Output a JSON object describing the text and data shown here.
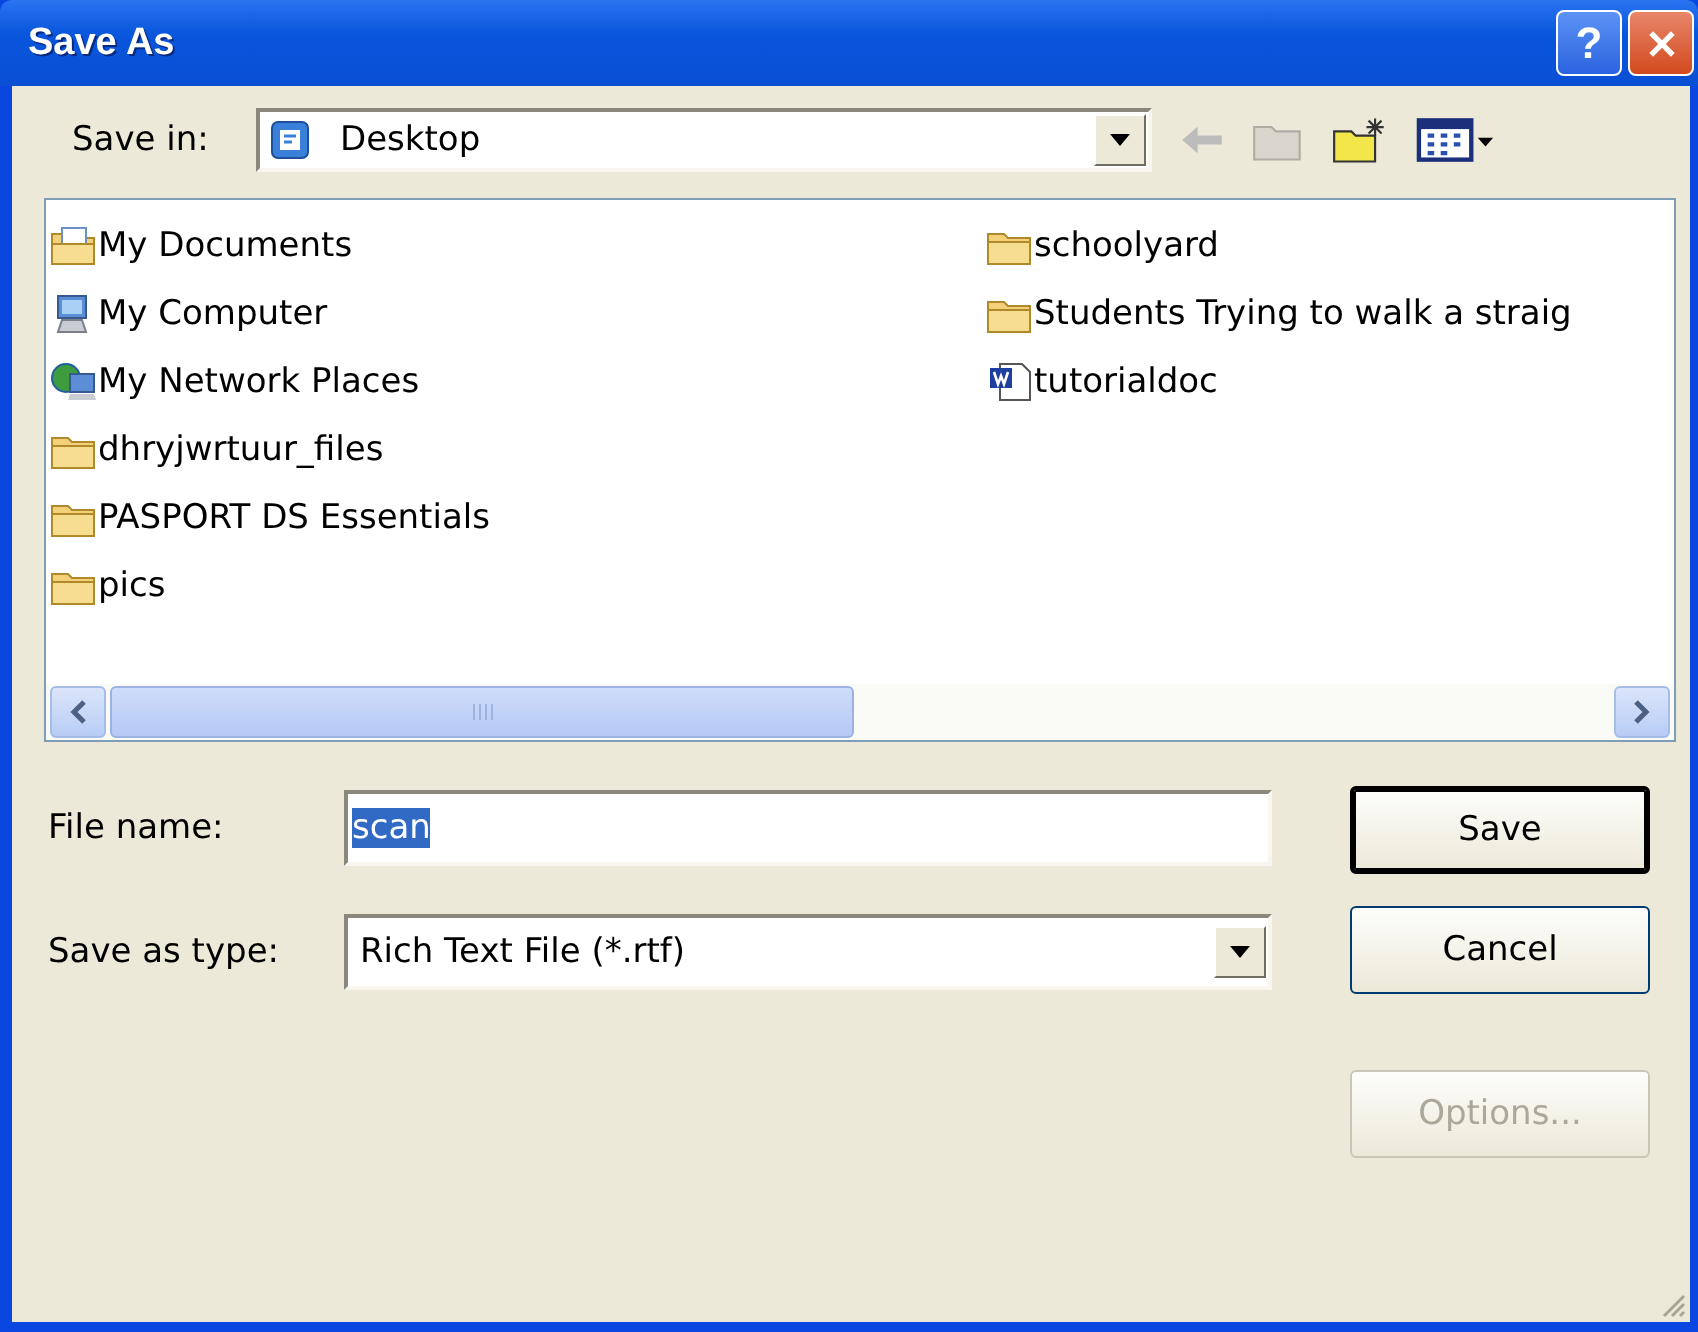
{
  "window": {
    "title": "Save As",
    "help_glyph": "?"
  },
  "save_in": {
    "label": "Save in:",
    "value": "Desktop",
    "kind": "desktop"
  },
  "files": [
    {
      "name": "My Documents",
      "kind": "documents"
    },
    {
      "name": "My Computer",
      "kind": "computer"
    },
    {
      "name": "My Network Places",
      "kind": "network"
    },
    {
      "name": "dhryjwrtuur_files",
      "kind": "folder"
    },
    {
      "name": "PASPORT DS Essentials",
      "kind": "folder"
    },
    {
      "name": "pics",
      "kind": "folder"
    },
    {
      "name": "schoolyard",
      "kind": "folder"
    },
    {
      "name": "Students Trying to walk a straig",
      "kind": "folder"
    },
    {
      "name": "tutorialdoc",
      "kind": "word"
    }
  ],
  "file_name": {
    "label": "File name:",
    "value": "scan",
    "text_selected": true
  },
  "save_as_type": {
    "label": "Save as type:",
    "value": "Rich Text File (*.rtf)"
  },
  "buttons": [
    {
      "label": "Save",
      "default": true,
      "disabled": false
    },
    {
      "label": "Cancel",
      "default": false,
      "disabled": false
    },
    {
      "label": "Options...",
      "default": false,
      "disabled": true
    }
  ]
}
